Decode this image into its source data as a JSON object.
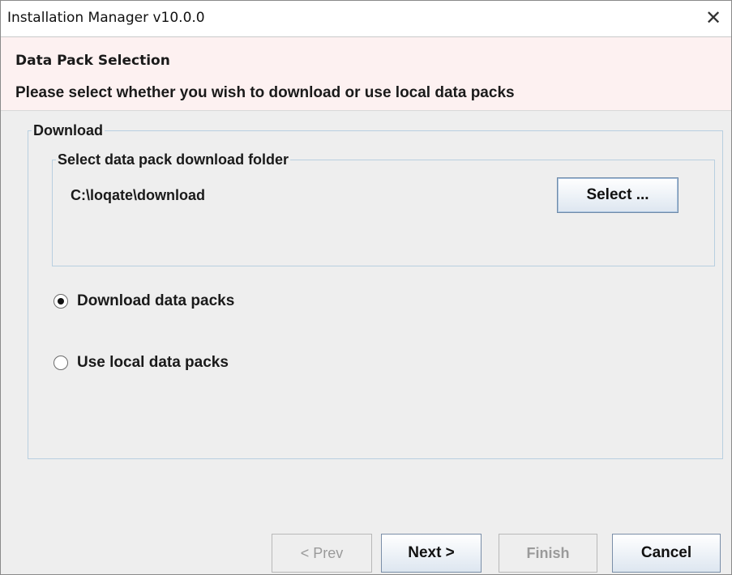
{
  "window": {
    "title": "Installation Manager v10.0.0",
    "close_glyph": "✕"
  },
  "header": {
    "title": "Data Pack Selection",
    "subtitle": "Please select whether you wish to download or use local data packs"
  },
  "download_group": {
    "legend": "Download",
    "folder_group": {
      "legend": "Select data pack download folder",
      "path": "C:\\loqate\\download",
      "select_button": "Select ..."
    },
    "options": [
      {
        "label": "Download data packs",
        "selected": true
      },
      {
        "label": "Use local data packs",
        "selected": false
      }
    ]
  },
  "footer": {
    "prev": {
      "label": "< Prev",
      "enabled": false
    },
    "next": {
      "label": "Next >",
      "enabled": true
    },
    "finish": {
      "label": "Finish",
      "enabled": false
    },
    "cancel": {
      "label": "Cancel",
      "enabled": true
    }
  },
  "colors": {
    "header_background": "#fdf1f1",
    "group_border": "#b8cfe0",
    "button_border": "#7a8ea8",
    "disabled_text": "#9a9a9a"
  }
}
